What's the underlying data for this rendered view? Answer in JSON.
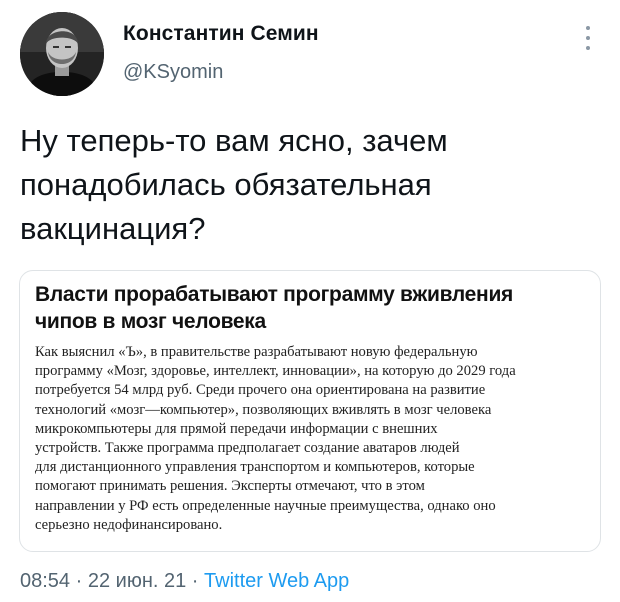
{
  "author": {
    "name": "Константин Семин",
    "handle": "@KSyomin"
  },
  "tweet": {
    "text_lines": [
      "Ну теперь-то вам ясно, зачем",
      "понадобилась обязательная",
      "вакцинация?"
    ]
  },
  "card": {
    "headline_lines": [
      "Власти прорабатывают программу вживления",
      "чипов в мозг человека"
    ],
    "body_lines": [
      "Как выяснил «Ъ», в правительстве разрабатывают новую федеральную",
      "программу «Мозг, здоровье, интеллект, инновации», на которую до 2029 года",
      "потребуется 54 млрд руб. Среди прочего она ориентирована на развитие",
      "технологий «мозг—компьютер», позволяющих вживлять в мозг человека",
      "микрокомпьютеры для прямой передачи информации с внешних",
      "устройств. Также программа предполагает создание аватаров людей",
      "для дистанционного управления транспортом и компьютеров, которые",
      "помогают принимать решения. Эксперты отмечают, что в этом",
      "направлении у РФ есть определенные научные преимущества, однако оно",
      "серьезно недофинансировано."
    ]
  },
  "meta": {
    "time": "08:54",
    "date": "22 июн. 21",
    "separator": " · ",
    "source": "Twitter Web App"
  },
  "icons": {
    "more": "more-vertical-icon"
  },
  "colors": {
    "primary_text": "#0f1419",
    "secondary_text": "#536471",
    "link": "#1d9bf0",
    "card_border": "#dfe3e6"
  }
}
